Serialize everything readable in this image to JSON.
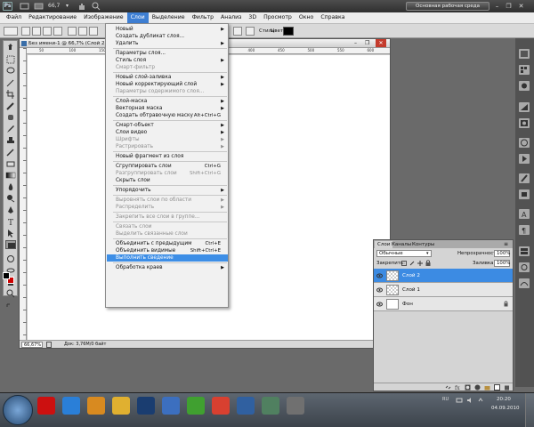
{
  "app": {
    "logo": "Ps",
    "zoom": "66,7",
    "workspace": "Основная рабочая среда",
    "window_controls": {
      "minimize": "–",
      "restore": "❐",
      "close": "✕"
    }
  },
  "menubar": [
    {
      "label": "Файл"
    },
    {
      "label": "Редактирование"
    },
    {
      "label": "Изображение"
    },
    {
      "label": "Слои",
      "active": true
    },
    {
      "label": "Выделение"
    },
    {
      "label": "Фильтр"
    },
    {
      "label": "Анализ"
    },
    {
      "label": "3D"
    },
    {
      "label": "Просмотр"
    },
    {
      "label": "Окно"
    },
    {
      "label": "Справка"
    }
  ],
  "options_bar": {
    "styles_label": "Стиль:",
    "color_label": "Цвет:",
    "color": "#000000"
  },
  "document": {
    "title": "Без имени-1 @ 66,7% (Слой 2, RGB",
    "ruler_labels": [
      "50",
      "100",
      "150",
      "200",
      "250",
      "300",
      "350",
      "400",
      "450",
      "500",
      "550",
      "600"
    ],
    "zoom_field": "66,67%",
    "info": "Док: 3,76М/0 байт"
  },
  "dropdown": {
    "items": [
      {
        "label": "Новый",
        "arrow": true
      },
      {
        "label": "Создать дубликат слоя..."
      },
      {
        "label": "Удалить",
        "arrow": true
      },
      {
        "sep": true
      },
      {
        "label": "Параметры слоя..."
      },
      {
        "label": "Стиль слоя",
        "arrow": true
      },
      {
        "label": "Смарт-фильтр",
        "disabled": true
      },
      {
        "sep": true
      },
      {
        "label": "Новый слой-заливка",
        "arrow": true
      },
      {
        "label": "Новый корректирующий слой",
        "arrow": true
      },
      {
        "label": "Параметры содержимого слоя...",
        "disabled": true
      },
      {
        "sep": true
      },
      {
        "label": "Слой-маска",
        "arrow": true
      },
      {
        "label": "Векторная маска",
        "arrow": true
      },
      {
        "label": "Создать обтравочную маску",
        "shortcut": "Alt+Ctrl+G"
      },
      {
        "sep": true
      },
      {
        "label": "Смарт-объект",
        "arrow": true
      },
      {
        "label": "Слои видео",
        "arrow": true
      },
      {
        "label": "Шрифты",
        "disabled": true,
        "arrow": true
      },
      {
        "label": "Растрировать",
        "disabled": true,
        "arrow": true
      },
      {
        "sep": true
      },
      {
        "label": "Новый фрагмент из слоя"
      },
      {
        "sep": true
      },
      {
        "label": "Сгруппировать слои",
        "shortcut": "Ctrl+G"
      },
      {
        "label": "Разгруппировать слои",
        "shortcut": "Shift+Ctrl+G",
        "disabled": true
      },
      {
        "label": "Скрыть слои"
      },
      {
        "sep": true
      },
      {
        "label": "Упорядочить",
        "arrow": true
      },
      {
        "sep": true
      },
      {
        "label": "Выровнять слои по области",
        "disabled": true,
        "arrow": true
      },
      {
        "label": "Распределить",
        "disabled": true,
        "arrow": true
      },
      {
        "sep": true
      },
      {
        "label": "Закрепить все слои в группе...",
        "disabled": true
      },
      {
        "sep": true
      },
      {
        "label": "Связать слои",
        "disabled": true
      },
      {
        "label": "Выделить связанные слои",
        "disabled": true
      },
      {
        "sep": true
      },
      {
        "label": "Объединить с предыдущим",
        "shortcut": "Ctrl+E"
      },
      {
        "label": "Объединить видимые",
        "shortcut": "Shift+Ctrl+E"
      },
      {
        "label": "Выполнить сведение",
        "highlight": true
      },
      {
        "sep": true
      },
      {
        "label": "Обработка краев",
        "arrow": true
      }
    ]
  },
  "layers_panel": {
    "tabs": [
      "Слои",
      "Каналы",
      "Контуры"
    ],
    "blend_mode": "Обычные",
    "opacity_label": "Непрозрачность:",
    "opacity_value": "100%",
    "lock_label": "Закрепить:",
    "fill_label": "Заливка:",
    "fill_value": "100%",
    "layers": [
      {
        "name": "Слой 2",
        "selected": true,
        "thumb": "checker"
      },
      {
        "name": "Слой 1",
        "selected": false,
        "thumb": "checker"
      },
      {
        "name": "Фон",
        "selected": false,
        "thumb": "white",
        "locked": true
      }
    ]
  },
  "taskbar": {
    "apps": [
      {
        "icon": "opera-icon",
        "color": "#cc1010"
      },
      {
        "icon": "ie-icon",
        "color": "#2a7fd8"
      },
      {
        "icon": "media-icon",
        "color": "#d88a20"
      },
      {
        "icon": "folder-icon",
        "color": "#e0b030"
      },
      {
        "icon": "photoshop-icon",
        "color": "#1a3d70"
      },
      {
        "icon": "word-icon",
        "color": "#3c6fbf"
      },
      {
        "icon": "clover-icon",
        "color": "#40a030"
      },
      {
        "icon": "chrome-icon",
        "color": "#d84030"
      },
      {
        "icon": "windows-icon",
        "color": "#3060a0"
      },
      {
        "icon": "monitor-icon",
        "color": "#508060"
      },
      {
        "icon": "pen-icon",
        "color": "#707070"
      }
    ],
    "lang": "RU",
    "time": "20:20",
    "date": "04.09.2010"
  }
}
